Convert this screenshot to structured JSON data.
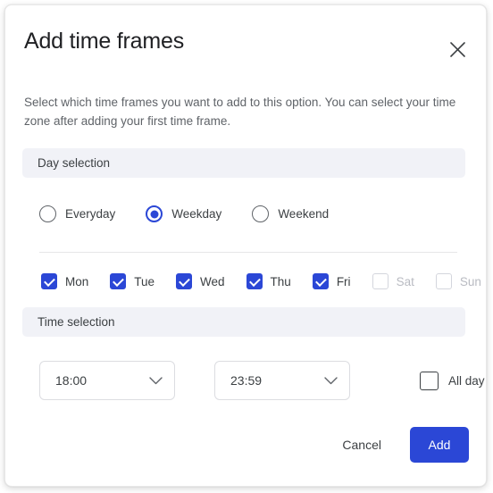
{
  "dialog": {
    "title": "Add time frames",
    "description": "Select which time frames you want to add to this option. You can select your time zone after adding your first time frame.",
    "close_icon": "close-icon"
  },
  "day_selection": {
    "header": "Day selection",
    "options": [
      {
        "label": "Everyday",
        "selected": false
      },
      {
        "label": "Weekday",
        "selected": true
      },
      {
        "label": "Weekend",
        "selected": false
      }
    ],
    "days": [
      {
        "label": "Mon",
        "checked": true,
        "disabled": false
      },
      {
        "label": "Tue",
        "checked": true,
        "disabled": false
      },
      {
        "label": "Wed",
        "checked": true,
        "disabled": false
      },
      {
        "label": "Thu",
        "checked": true,
        "disabled": false
      },
      {
        "label": "Fri",
        "checked": true,
        "disabled": false
      },
      {
        "label": "Sat",
        "checked": false,
        "disabled": true
      },
      {
        "label": "Sun",
        "checked": false,
        "disabled": true
      }
    ]
  },
  "time_selection": {
    "header": "Time selection",
    "start_time": "18:00",
    "end_time": "23:59",
    "dropdown_icon": "chevron-down-icon",
    "all_day": {
      "label": "All day",
      "checked": false
    }
  },
  "footer": {
    "cancel_label": "Cancel",
    "add_label": "Add"
  },
  "colors": {
    "accent": "#2b47d6",
    "section_bar": "#f1f2f7",
    "text_primary": "#3c4043",
    "text_secondary": "#5f6368",
    "disabled": "#b9bbc2",
    "border": "#dcdde1"
  }
}
